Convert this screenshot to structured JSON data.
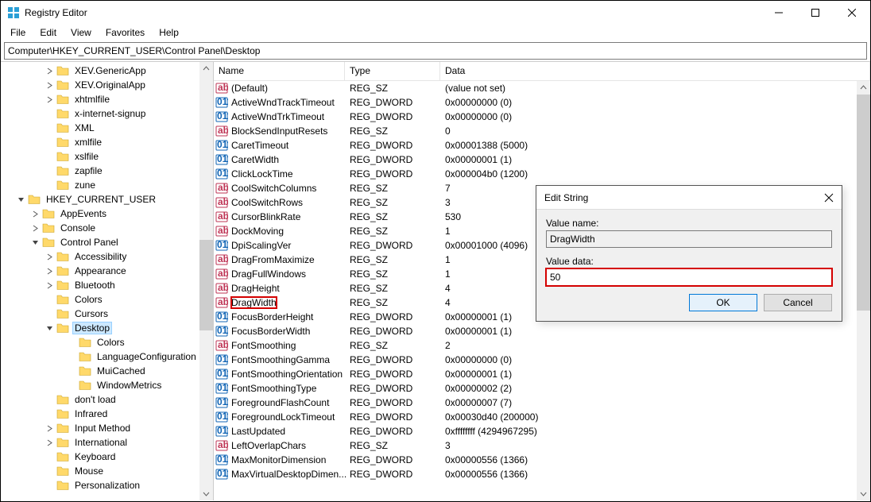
{
  "window": {
    "title": "Registry Editor"
  },
  "menu": [
    "File",
    "Edit",
    "View",
    "Favorites",
    "Help"
  ],
  "address": "Computer\\HKEY_CURRENT_USER\\Control Panel\\Desktop",
  "tree": [
    {
      "indent": 3,
      "tw": "closed",
      "label": "XEV.GenericApp"
    },
    {
      "indent": 3,
      "tw": "closed",
      "label": "XEV.OriginalApp"
    },
    {
      "indent": 3,
      "tw": "closed",
      "label": "xhtmlfile"
    },
    {
      "indent": 3,
      "tw": "none",
      "label": "x-internet-signup"
    },
    {
      "indent": 3,
      "tw": "none",
      "label": "XML"
    },
    {
      "indent": 3,
      "tw": "none",
      "label": "xmlfile"
    },
    {
      "indent": 3,
      "tw": "none",
      "label": "xslfile"
    },
    {
      "indent": 3,
      "tw": "none",
      "label": "zapfile"
    },
    {
      "indent": 3,
      "tw": "none",
      "label": "zune"
    },
    {
      "indent": 1,
      "tw": "open",
      "label": "HKEY_CURRENT_USER"
    },
    {
      "indent": 2,
      "tw": "closed",
      "label": "AppEvents"
    },
    {
      "indent": 2,
      "tw": "closed",
      "label": "Console"
    },
    {
      "indent": 2,
      "tw": "open",
      "label": "Control Panel"
    },
    {
      "indent": 3,
      "tw": "closed",
      "label": "Accessibility"
    },
    {
      "indent": 3,
      "tw": "closed",
      "label": "Appearance"
    },
    {
      "indent": 3,
      "tw": "closed",
      "label": "Bluetooth"
    },
    {
      "indent": 3,
      "tw": "none",
      "label": "Colors"
    },
    {
      "indent": 3,
      "tw": "none",
      "label": "Cursors"
    },
    {
      "indent": 3,
      "tw": "open",
      "label": "Desktop",
      "selected": true
    },
    {
      "indent": 4,
      "tw": "none",
      "label": "Colors",
      "leaf": true
    },
    {
      "indent": 4,
      "tw": "none",
      "label": "LanguageConfiguration",
      "leaf": true
    },
    {
      "indent": 4,
      "tw": "none",
      "label": "MuiCached",
      "leaf": true
    },
    {
      "indent": 4,
      "tw": "none",
      "label": "WindowMetrics",
      "leaf": true
    },
    {
      "indent": 3,
      "tw": "none",
      "label": "don't load"
    },
    {
      "indent": 3,
      "tw": "none",
      "label": "Infrared"
    },
    {
      "indent": 3,
      "tw": "closed",
      "label": "Input Method"
    },
    {
      "indent": 3,
      "tw": "closed",
      "label": "International"
    },
    {
      "indent": 3,
      "tw": "none",
      "label": "Keyboard"
    },
    {
      "indent": 3,
      "tw": "none",
      "label": "Mouse"
    },
    {
      "indent": 3,
      "tw": "none",
      "label": "Personalization"
    }
  ],
  "columns": {
    "name": "Name",
    "type": "Type",
    "data": "Data"
  },
  "rows": [
    {
      "icon": "sz",
      "name": "(Default)",
      "type": "REG_SZ",
      "data": "(value not set)"
    },
    {
      "icon": "dw",
      "name": "ActiveWndTrackTimeout",
      "type": "REG_DWORD",
      "data": "0x00000000 (0)"
    },
    {
      "icon": "dw",
      "name": "ActiveWndTrkTimeout",
      "type": "REG_DWORD",
      "data": "0x00000000 (0)"
    },
    {
      "icon": "sz",
      "name": "BlockSendInputResets",
      "type": "REG_SZ",
      "data": "0"
    },
    {
      "icon": "dw",
      "name": "CaretTimeout",
      "type": "REG_DWORD",
      "data": "0x00001388 (5000)"
    },
    {
      "icon": "dw",
      "name": "CaretWidth",
      "type": "REG_DWORD",
      "data": "0x00000001 (1)"
    },
    {
      "icon": "dw",
      "name": "ClickLockTime",
      "type": "REG_DWORD",
      "data": "0x000004b0 (1200)"
    },
    {
      "icon": "sz",
      "name": "CoolSwitchColumns",
      "type": "REG_SZ",
      "data": "7"
    },
    {
      "icon": "sz",
      "name": "CoolSwitchRows",
      "type": "REG_SZ",
      "data": "3"
    },
    {
      "icon": "sz",
      "name": "CursorBlinkRate",
      "type": "REG_SZ",
      "data": "530"
    },
    {
      "icon": "sz",
      "name": "DockMoving",
      "type": "REG_SZ",
      "data": "1"
    },
    {
      "icon": "dw",
      "name": "DpiScalingVer",
      "type": "REG_DWORD",
      "data": "0x00001000 (4096)"
    },
    {
      "icon": "sz",
      "name": "DragFromMaximize",
      "type": "REG_SZ",
      "data": "1"
    },
    {
      "icon": "sz",
      "name": "DragFullWindows",
      "type": "REG_SZ",
      "data": "1"
    },
    {
      "icon": "sz",
      "name": "DragHeight",
      "type": "REG_SZ",
      "data": "4"
    },
    {
      "icon": "sz",
      "name": "DragWidth",
      "type": "REG_SZ",
      "data": "4",
      "hl": true
    },
    {
      "icon": "dw",
      "name": "FocusBorderHeight",
      "type": "REG_DWORD",
      "data": "0x00000001 (1)"
    },
    {
      "icon": "dw",
      "name": "FocusBorderWidth",
      "type": "REG_DWORD",
      "data": "0x00000001 (1)"
    },
    {
      "icon": "sz",
      "name": "FontSmoothing",
      "type": "REG_SZ",
      "data": "2"
    },
    {
      "icon": "dw",
      "name": "FontSmoothingGamma",
      "type": "REG_DWORD",
      "data": "0x00000000 (0)"
    },
    {
      "icon": "dw",
      "name": "FontSmoothingOrientation",
      "type": "REG_DWORD",
      "data": "0x00000001 (1)"
    },
    {
      "icon": "dw",
      "name": "FontSmoothingType",
      "type": "REG_DWORD",
      "data": "0x00000002 (2)"
    },
    {
      "icon": "dw",
      "name": "ForegroundFlashCount",
      "type": "REG_DWORD",
      "data": "0x00000007 (7)"
    },
    {
      "icon": "dw",
      "name": "ForegroundLockTimeout",
      "type": "REG_DWORD",
      "data": "0x00030d40 (200000)"
    },
    {
      "icon": "dw",
      "name": "LastUpdated",
      "type": "REG_DWORD",
      "data": "0xffffffff (4294967295)"
    },
    {
      "icon": "sz",
      "name": "LeftOverlapChars",
      "type": "REG_SZ",
      "data": "3"
    },
    {
      "icon": "dw",
      "name": "MaxMonitorDimension",
      "type": "REG_DWORD",
      "data": "0x00000556 (1366)"
    },
    {
      "icon": "dw",
      "name": "MaxVirtualDesktopDimen...",
      "type": "REG_DWORD",
      "data": "0x00000556 (1366)"
    }
  ],
  "dialog": {
    "title": "Edit String",
    "value_name_label": "Value name:",
    "value_name": "DragWidth",
    "value_data_label": "Value data:",
    "value_data": "50",
    "ok": "OK",
    "cancel": "Cancel"
  }
}
